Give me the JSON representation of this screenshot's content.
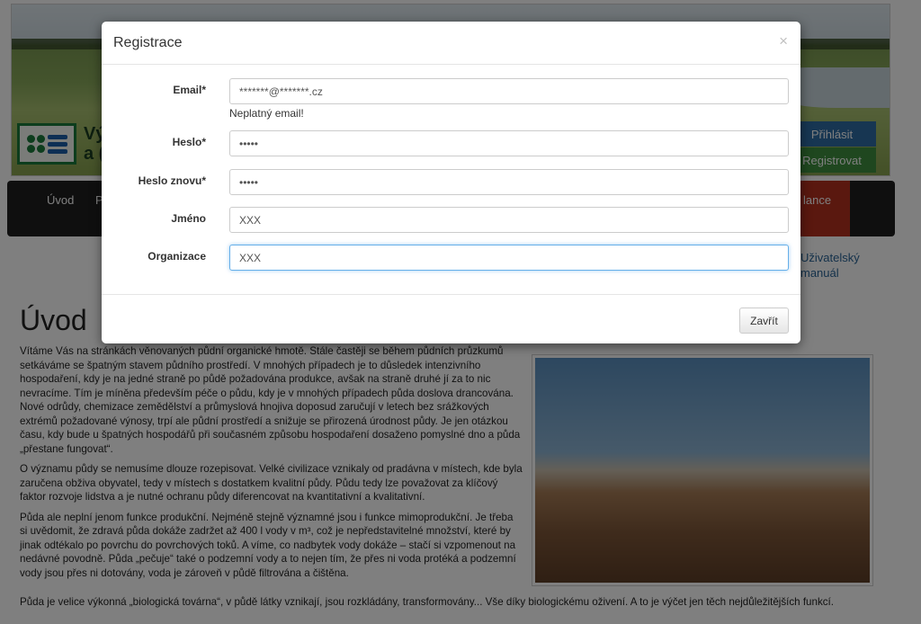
{
  "background": {
    "logo_text": "Vý\na (",
    "login_button": "Přihlásit",
    "register_button": "Registrovat",
    "nav": [
      "Úvod",
      "P"
    ],
    "nav_highlight": "lance",
    "side_link": "Uživatelský\nmanuál",
    "page_title": "Úvod",
    "paragraphs": [
      "Vítáme Vás na stránkách věnovaných půdní organické hmotě. Stále častěji se během půdních průzkumů setkáváme se špatným stavem půdního prostředí. V mnohých případech je to důsledek intenzivního hospodaření, kdy je na jedné straně po půdě požadována produkce, avšak na straně druhé jí za to nic nevracíme. Tím je míněna především péče o půdu, kdy je v mnohých případech půda doslova drancována. Nové odrůdy, chemizace zemědělství a průmyslová hnojiva doposud zaručují v letech bez srážkových extrémů požadované výnosy, trpí ale půdní prostředí a snižuje se přirozená úrodnost půdy. Je jen otázkou času, kdy bude u špatných hospodářů při současném způsobu hospodaření dosaženo pomyslné dno a půda „přestane fungovat“.",
      "O významu půdy se nemusíme dlouze rozepisovat. Velké civilizace vznikaly od pradávna v místech, kde byla zaručena obživa obyvatel, tedy v místech s dostatkem kvalitní půdy. Půdu tedy lze považovat za klíčový faktor rozvoje lidstva a je nutné ochranu půdy diferencovat na kvantitativní a kvalitativní.",
      "Půda ale neplní jenom funkce produkční. Nejméně stejně významné jsou i funkce mimoprodukční. Je třeba si uvědomit, že zdravá půda dokáže zadržet až 400 l vody v m³, což je nepředstavitelné množství, které by jinak odtékalo po povrchu do povrchových toků. A víme, co nadbytek vody dokáže – stačí si vzpomenout na nedávné povodně. Půda „pečuje“ také o podzemní vody a to nejen tím, že přes ni voda protéká a podzemní vody jsou přes ni dotovány, voda je zároveň v půdě filtrována a čištěna."
    ],
    "paragraph_wide": "Půda je velice výkonná „biologická továrna“, v půdě látky vznikají, jsou rozkládány, transformovány... Vše díky biologickému oživení. A to je výčet jen těch nejdůležitějších funkcí."
  },
  "modal": {
    "title": "Registrace",
    "close_symbol": "×",
    "fields": {
      "email": {
        "label": "Email*",
        "value": "*******@*******.cz",
        "help": "Neplatný email!"
      },
      "password": {
        "label": "Heslo*",
        "value": "•••••"
      },
      "password_again": {
        "label": "Heslo znovu*",
        "value": "•••••"
      },
      "name": {
        "label": "Jméno",
        "value": "XXX"
      },
      "organization": {
        "label": "Organizace",
        "value": "XXX"
      }
    },
    "footer_button": "Zavřít"
  },
  "colors": {
    "overlay": "rgba(0,0,0,0.5)",
    "focus_border": "#66afe9",
    "login_blue": "#2e6da4",
    "register_green": "#3e8f3e",
    "navbar": "#1f1f1f",
    "nav_red": "#b5301f"
  }
}
